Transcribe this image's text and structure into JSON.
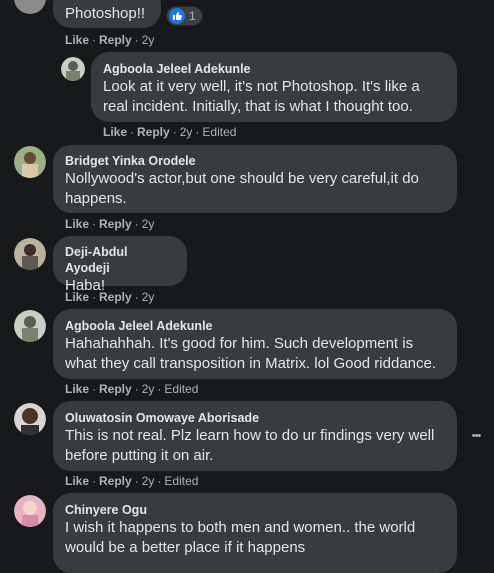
{
  "comments": [
    {
      "text": "Photoshop!!",
      "reaction_count": "1",
      "actions": {
        "like": "Like",
        "reply": "Reply",
        "time": "2y"
      }
    },
    {
      "author": "Agboola Jeleel Adekunle",
      "text": "Look at it very well, it's not Photoshop. It's like a real incident. Initially, that is what I thought too.",
      "actions": {
        "like": "Like",
        "reply": "Reply",
        "time": "2y",
        "edited": "Edited"
      }
    },
    {
      "author": "Bridget Yinka Orodele",
      "text": "Nollywood's actor,but one should be very careful,it do happens.",
      "actions": {
        "like": "Like",
        "reply": "Reply",
        "time": "2y"
      }
    },
    {
      "author": "Deji-Abdul Ayodeji",
      "text": "Haba!",
      "actions": {
        "like": "Like",
        "reply": "Reply",
        "time": "2y"
      }
    },
    {
      "author": "Agboola Jeleel Adekunle",
      "text": "Hahahahhah. It's good for him. Such development is what they call transposition in Matrix. lol Good riddance.",
      "actions": {
        "like": "Like",
        "reply": "Reply",
        "time": "2y",
        "edited": "Edited"
      }
    },
    {
      "author": "Oluwatosin Omowaye Aborisade",
      "text": "This is not real. Plz learn how to do ur findings very well before putting it on air.",
      "actions": {
        "like": "Like",
        "reply": "Reply",
        "time": "2y",
        "edited": "Edited"
      }
    },
    {
      "author": "Chinyere Ogu",
      "text": "I wish it happens to both men and women.. the world would be a better place if it happens"
    }
  ],
  "more_options_glyph": "•••",
  "colors": {
    "background": "#18191a",
    "bubble": "#3a3b3c",
    "like_blue": "#1877f2",
    "secondary_text": "#b0b3b8"
  }
}
